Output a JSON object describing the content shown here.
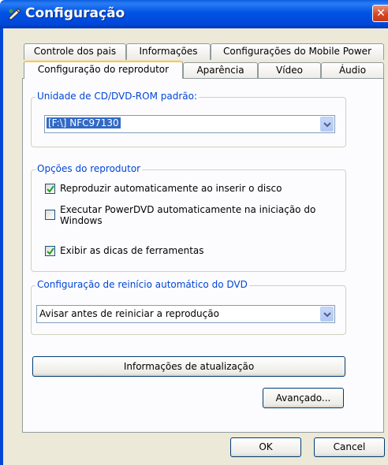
{
  "window": {
    "title": "Configuração"
  },
  "tabs": {
    "row_back": [
      "Controle dos pais",
      "Informações",
      "Configurações do Mobile Power"
    ],
    "row_front": [
      "Configuração do reprodutor",
      "Aparência",
      "Vídeo",
      "Áudio"
    ],
    "active": "Configuração do reprodutor"
  },
  "cdrom": {
    "legend": "Unidade de CD/DVD-ROM padrão:",
    "value": "[F:\\] NFC97130"
  },
  "player_options": {
    "legend": "Opções do reprodutor",
    "autoplay": {
      "label": "Reproduzir automaticamente ao inserir o disco",
      "checked": true
    },
    "autostart": {
      "label_line1": "Executar PowerDVD automaticamente na iniciação do",
      "label_line2": "Windows",
      "checked": false
    },
    "tooltips": {
      "label": "Exibir as dicas de ferramentas",
      "checked": true
    }
  },
  "resume": {
    "legend": "Configuração de reinício automático do DVD",
    "value": "Avisar antes de reiniciar a reprodução"
  },
  "buttons": {
    "update_info": "Informações de atualização",
    "advanced": "Avançado...",
    "ok": "OK",
    "cancel": "Cancel"
  }
}
